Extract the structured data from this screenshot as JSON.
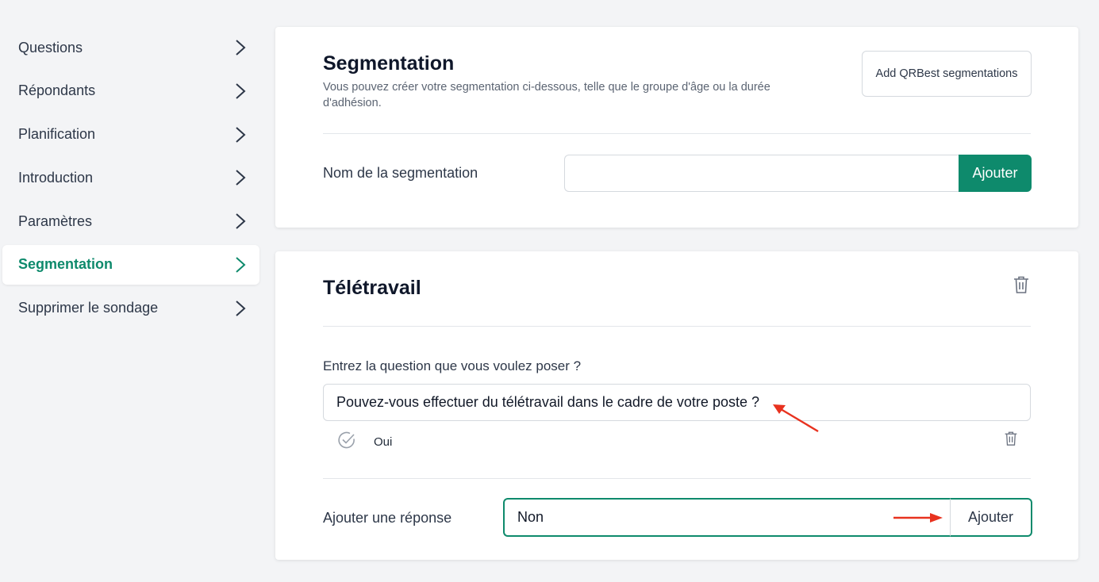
{
  "sidebar": {
    "items": [
      {
        "label": "Questions"
      },
      {
        "label": "Répondants"
      },
      {
        "label": "Planification"
      },
      {
        "label": "Introduction"
      },
      {
        "label": "Paramètres"
      },
      {
        "label": "Segmentation",
        "active": true
      },
      {
        "label": "Supprimer le sondage"
      }
    ]
  },
  "segmentation_card": {
    "title": "Segmentation",
    "description": "Vous pouvez créer votre segmentation ci-dessous, telle que le groupe d'âge ou la durée d'adhésion.",
    "qrbest_button": "Add QRBest segmentations",
    "name_label": "Nom de la segmentation",
    "name_value": "",
    "add_button": "Ajouter"
  },
  "segment": {
    "title": "Télétravail",
    "question_label": "Entrez la question que vous voulez poser ?",
    "question_value": "Pouvez-vous effectuer du télétravail dans le cadre de votre poste ?",
    "answers": [
      {
        "label": "Oui"
      }
    ],
    "add_answer_label": "Ajouter une réponse",
    "add_answer_value": "Non",
    "add_answer_button": "Ajouter"
  },
  "colors": {
    "accent": "#0e8a6c",
    "annotation_arrow": "#e8321f"
  },
  "icons": [
    "chevron-right-icon",
    "trash-icon",
    "check-circle-icon",
    "annotation-arrow"
  ]
}
